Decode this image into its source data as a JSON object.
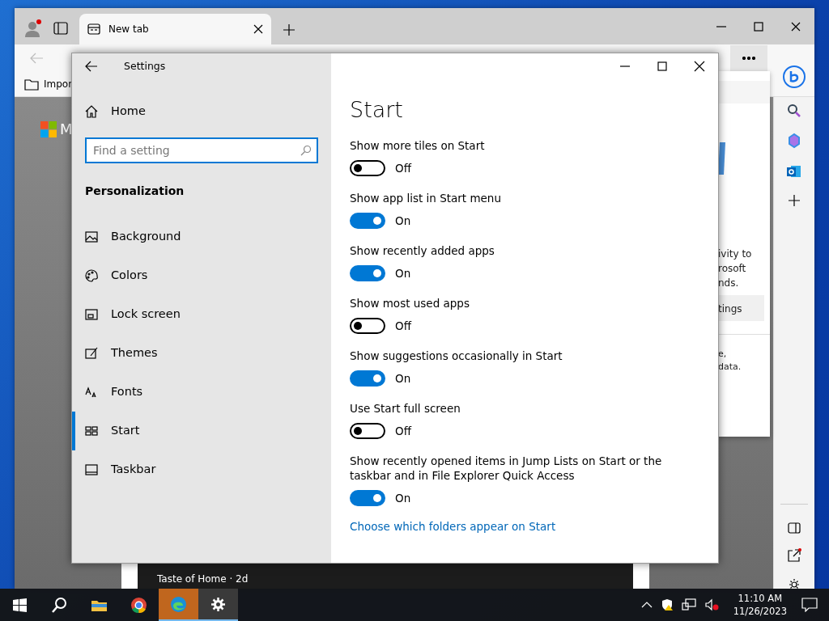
{
  "browser": {
    "tabs": [
      {
        "label": "New tab",
        "selected": true
      }
    ],
    "favorites": [
      {
        "label": "Impor"
      }
    ],
    "page": {
      "logo_text": "M",
      "panel_lines": [
        "ivity to",
        "rosoft",
        "nds."
      ],
      "panel_button": "tings",
      "panel_note": [
        "e,",
        "data."
      ],
      "news_source": "Taste of Home · 2d"
    }
  },
  "settings": {
    "title": "Settings",
    "home": "Home",
    "search": {
      "placeholder": "Find a setting"
    },
    "section": "Personalization",
    "nav": [
      {
        "kind": "background",
        "label": "Background",
        "selected": false
      },
      {
        "kind": "colors",
        "label": "Colors",
        "selected": false
      },
      {
        "kind": "lock",
        "label": "Lock screen",
        "selected": false
      },
      {
        "kind": "themes",
        "label": "Themes",
        "selected": false
      },
      {
        "kind": "fonts",
        "label": "Fonts",
        "selected": false
      },
      {
        "kind": "start",
        "label": "Start",
        "selected": true
      },
      {
        "kind": "taskbar",
        "label": "Taskbar",
        "selected": false
      }
    ],
    "heading": "Start",
    "toggles": [
      {
        "label": "Show more tiles on Start",
        "on": false,
        "state_text": "Off"
      },
      {
        "label": "Show app list in Start menu",
        "on": true,
        "state_text": "On"
      },
      {
        "label": "Show recently added apps",
        "on": true,
        "state_text": "On"
      },
      {
        "label": "Show most used apps",
        "on": false,
        "state_text": "Off"
      },
      {
        "label": "Show suggestions occasionally in Start",
        "on": true,
        "state_text": "On"
      },
      {
        "label": "Use Start full screen",
        "on": false,
        "state_text": "Off"
      },
      {
        "label": "Show recently opened items in Jump Lists on Start or the taskbar and in File Explorer Quick Access",
        "on": true,
        "state_text": "On"
      }
    ],
    "link": "Choose which folders appear on Start"
  },
  "taskbar": {
    "apps": [
      {
        "kind": "start",
        "running": false,
        "attention": false
      },
      {
        "kind": "search",
        "running": false,
        "attention": false
      },
      {
        "kind": "explorer",
        "running": false,
        "attention": false
      },
      {
        "kind": "chrome",
        "running": false,
        "attention": false
      },
      {
        "kind": "edge",
        "running": true,
        "attention": true
      },
      {
        "kind": "settings",
        "running": true,
        "attention": false
      }
    ],
    "time": "11:10 AM",
    "date": "11/26/2023"
  }
}
